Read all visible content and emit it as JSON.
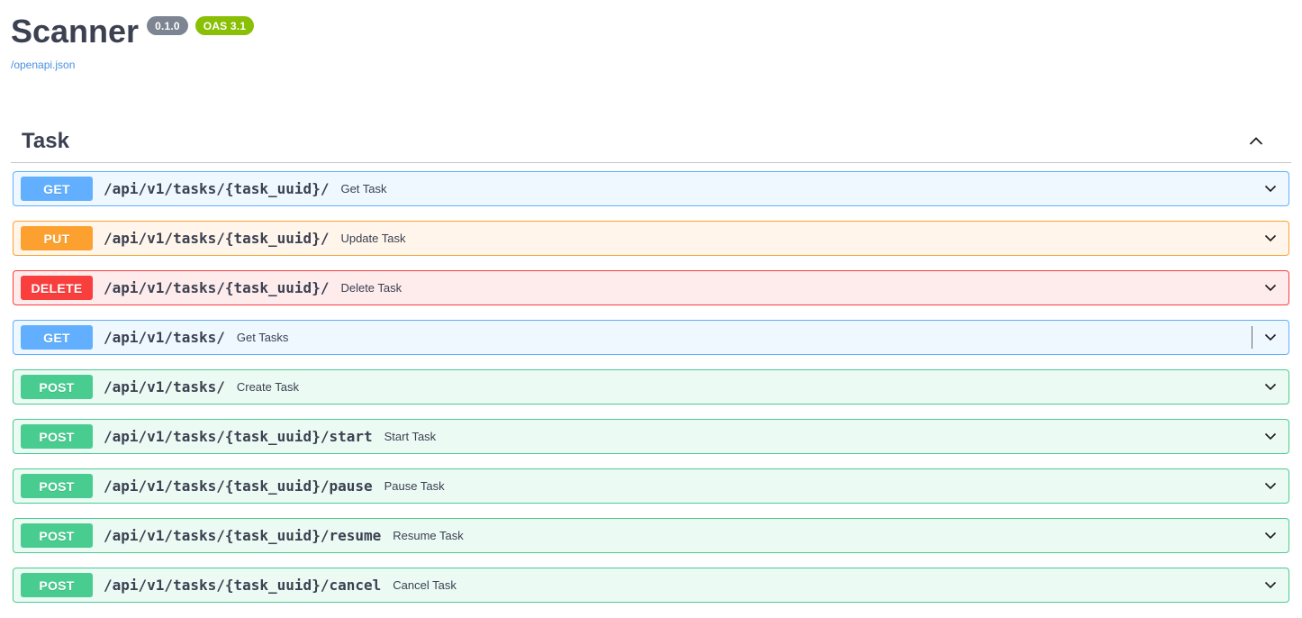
{
  "header": {
    "title": "Scanner",
    "version_badge": "0.1.0",
    "oas_badge": "OAS 3.1",
    "spec_link": "/openapi.json"
  },
  "section": {
    "title": "Task",
    "state_icon": "chevron-up",
    "expanded": true
  },
  "row_expand_icon": "chevron-down",
  "colors": {
    "get": "#61affe",
    "post": "#49cc90",
    "put": "#fca130",
    "delete": "#f93e3e",
    "version_badge_bg": "#7d8492",
    "oas_badge_bg": "#89bf04",
    "link": "#4990e2",
    "text": "#3b4151"
  },
  "operations": [
    {
      "method": "GET",
      "path": "/api/v1/tasks/{task_uuid}/",
      "summary": "Get Task",
      "method_color": "#61affe",
      "row_bg": "rgba(97,175,254,.1)",
      "text_caret": false
    },
    {
      "method": "PUT",
      "path": "/api/v1/tasks/{task_uuid}/",
      "summary": "Update Task",
      "method_color": "#fca130",
      "row_bg": "rgba(252,161,48,.1)",
      "text_caret": false
    },
    {
      "method": "DELETE",
      "path": "/api/v1/tasks/{task_uuid}/",
      "summary": "Delete Task",
      "method_color": "#f93e3e",
      "row_bg": "rgba(249,62,62,.1)",
      "text_caret": false
    },
    {
      "method": "GET",
      "path": "/api/v1/tasks/",
      "summary": "Get Tasks",
      "method_color": "#61affe",
      "row_bg": "rgba(97,175,254,.1)",
      "text_caret": true
    },
    {
      "method": "POST",
      "path": "/api/v1/tasks/",
      "summary": "Create Task",
      "method_color": "#49cc90",
      "row_bg": "rgba(73,204,144,.1)",
      "text_caret": false
    },
    {
      "method": "POST",
      "path": "/api/v1/tasks/{task_uuid}/start",
      "summary": "Start Task",
      "method_color": "#49cc90",
      "row_bg": "rgba(73,204,144,.1)",
      "text_caret": false
    },
    {
      "method": "POST",
      "path": "/api/v1/tasks/{task_uuid}/pause",
      "summary": "Pause Task",
      "method_color": "#49cc90",
      "row_bg": "rgba(73,204,144,.1)",
      "text_caret": false
    },
    {
      "method": "POST",
      "path": "/api/v1/tasks/{task_uuid}/resume",
      "summary": "Resume Task",
      "method_color": "#49cc90",
      "row_bg": "rgba(73,204,144,.1)",
      "text_caret": false
    },
    {
      "method": "POST",
      "path": "/api/v1/tasks/{task_uuid}/cancel",
      "summary": "Cancel Task",
      "method_color": "#49cc90",
      "row_bg": "rgba(73,204,144,.1)",
      "text_caret": false
    }
  ]
}
